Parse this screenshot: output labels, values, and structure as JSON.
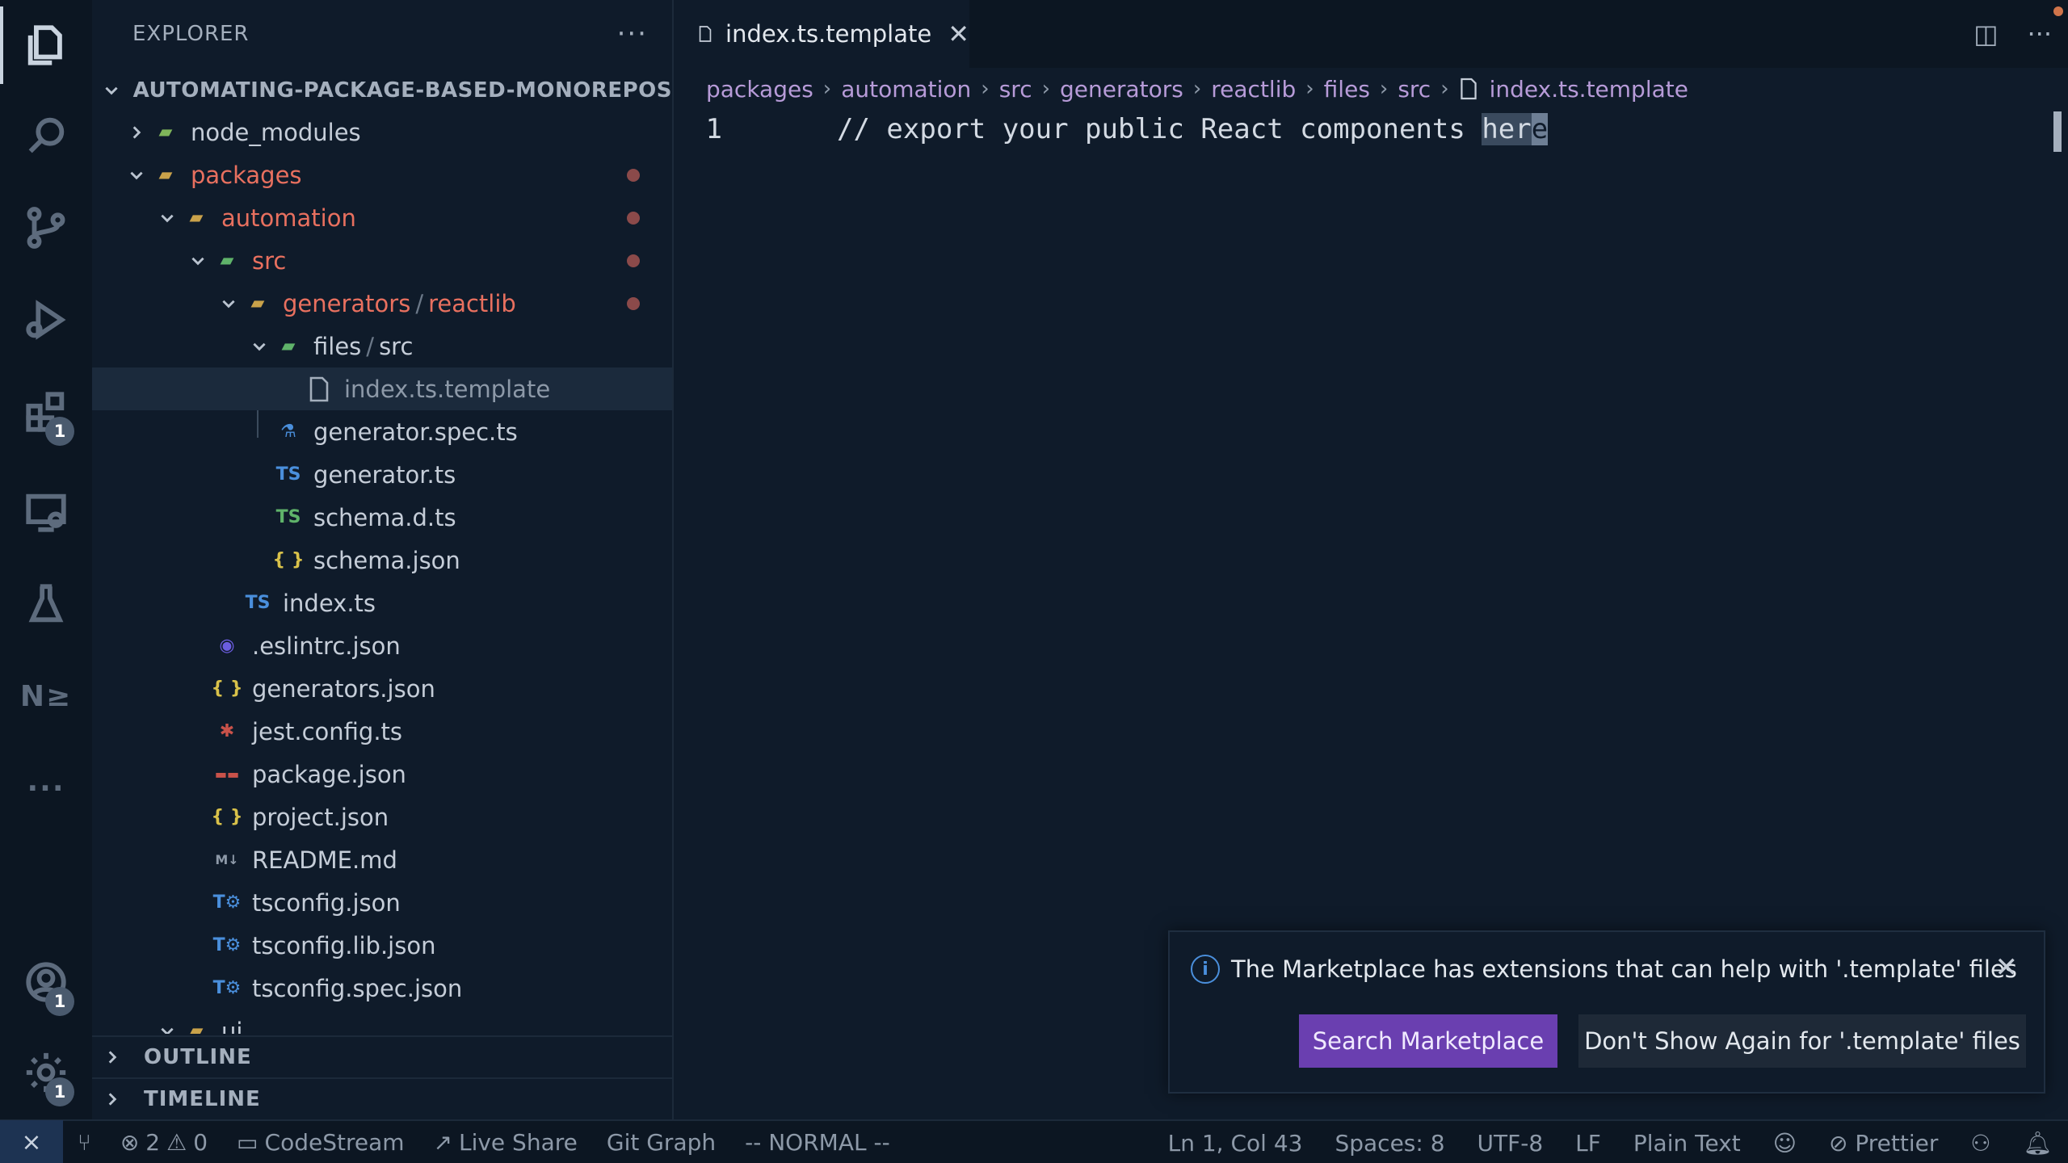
{
  "colors": {
    "accent": "#6a3fb0",
    "modified": "#e8705f",
    "background": "#0f1b2a"
  },
  "activity_bar": {
    "items": [
      {
        "icon": "files-icon"
      },
      {
        "icon": "search-icon"
      },
      {
        "icon": "source-control-icon"
      },
      {
        "icon": "run-debug-icon"
      },
      {
        "icon": "extensions-icon",
        "badge": "1"
      },
      {
        "icon": "remote-explorer-icon"
      },
      {
        "icon": "testing-icon"
      },
      {
        "icon": "nx-icon",
        "text": "N≥"
      },
      {
        "icon": "more-icon",
        "text": "···"
      }
    ],
    "accounts_badge": "1",
    "settings_badge": "1"
  },
  "sidebar": {
    "title": "EXPLORER",
    "more": "···",
    "root": "AUTOMATING-PACKAGE-BASED-MONOREPOS",
    "tree": {
      "node_modules": "node_modules",
      "packages": "packages",
      "automation": "automation",
      "src": "src",
      "generators": "generators",
      "reactlib": "reactlib",
      "files": "files",
      "files_src": "src",
      "sep": "/",
      "index_template": "index.ts.template",
      "generator_spec": "generator.spec.ts",
      "generator": "generator.ts",
      "schema_d": "schema.d.ts",
      "schema_json": "schema.json",
      "index_ts": "index.ts",
      "eslintrc": ".eslintrc.json",
      "generators_json": "generators.json",
      "jest_config": "jest.config.ts",
      "package_json": "package.json",
      "project_json": "project.json",
      "readme": "README.md",
      "tsconfig": "tsconfig.json",
      "tsconfig_lib": "tsconfig.lib.json",
      "tsconfig_spec": "tsconfig.spec.json",
      "ui": "ui"
    },
    "outline": "OUTLINE",
    "timeline": "TIMELINE"
  },
  "editor": {
    "tab": {
      "name": "index.ts.template",
      "close": "✕"
    },
    "breadcrumb": [
      "packages",
      "automation",
      "src",
      "generators",
      "reactlib",
      "files",
      "src",
      "index.ts.template"
    ],
    "line_number": "1",
    "code_before": "// export your public React components ",
    "code_highlight": "her",
    "code_cursor": "e"
  },
  "notification": {
    "message": "The Marketplace has extensions that can help with '.template' files",
    "primary_button": "Search Marketplace",
    "secondary_button": "Don't Show Again for '.template' files"
  },
  "status_bar": {
    "errors": "2",
    "warnings": "0",
    "codestream": "CodeStream",
    "live_share": "Live Share",
    "git_graph": "Git Graph",
    "vim_mode": "-- NORMAL --",
    "position": "Ln 1, Col 43",
    "spaces": "Spaces: 8",
    "encoding": "UTF-8",
    "eol": "LF",
    "language": "Plain Text",
    "prettier": "Prettier"
  }
}
